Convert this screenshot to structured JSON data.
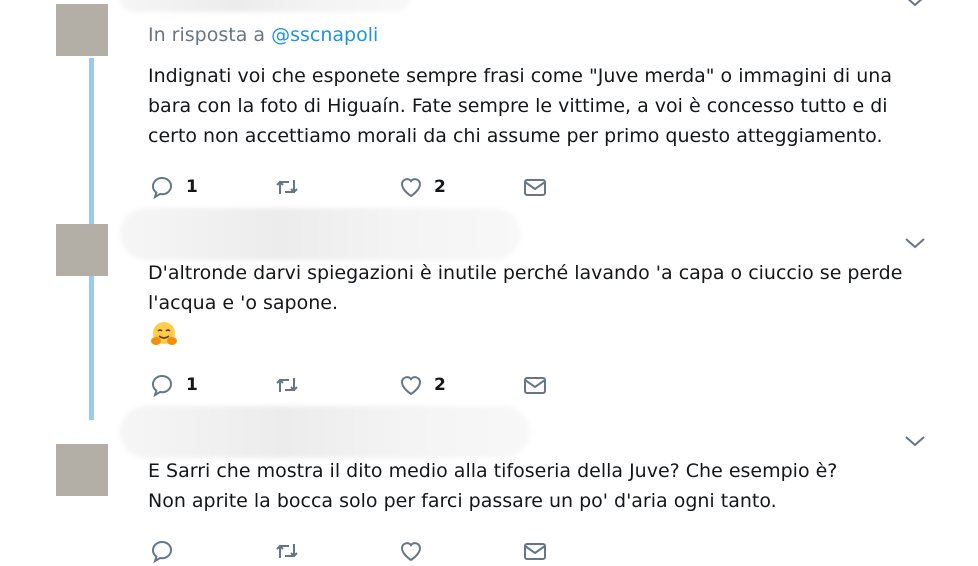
{
  "tweets": [
    {
      "reply_prefix": "In risposta a",
      "reply_handle": "@sscnapoli",
      "text": "Indignati voi che esponete sempre frasi come \"Juve merda\" o immagini di una\nbara con la foto di Higuaín. Fate sempre le vittime, a voi è concesso tutto e di\ncerto non accettiamo morali da chi assume per primo questo atteggiamento.",
      "reply_count": "1",
      "like_count": "2"
    },
    {
      "text": "D'altronde darvi spiegazioni è inutile perché lavando 'a capa o ciuccio se perde\nl'acqua e 'o sapone.",
      "emoji": "hugging-face",
      "reply_count": "1",
      "like_count": "2"
    },
    {
      "text": "E Sarri che mostra il dito medio alla tifoseria della Juve? Che esempio è?\nNon aprite la bocca solo per farci passare un po' d'aria ogni tanto."
    }
  ],
  "icons": {
    "reply": "reply-icon",
    "retweet": "retweet-icon",
    "like": "heart-icon",
    "dm": "envelope-icon",
    "more": "chevron-down-icon"
  },
  "colors": {
    "link": "#1b95e0",
    "secondary_text": "#657786",
    "thread_line": "#9cc9ee"
  }
}
